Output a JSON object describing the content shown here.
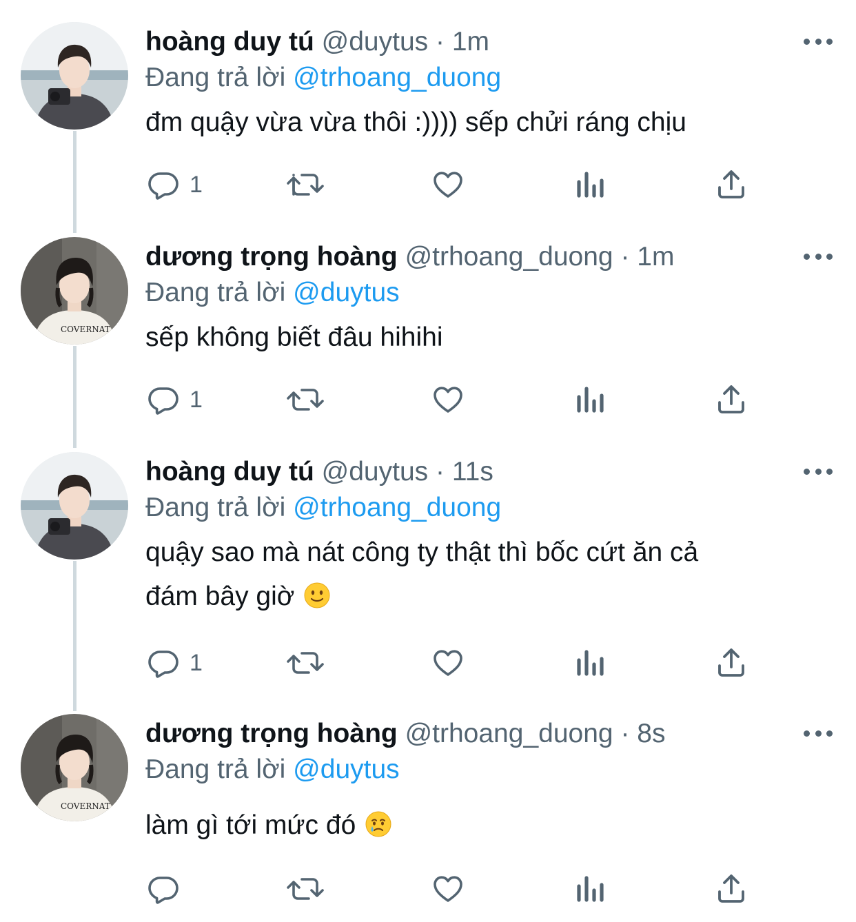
{
  "thread": {
    "reply_prefix": "Đang trả lời",
    "dot": "·",
    "tweets": [
      {
        "name": "hoàng duy tú",
        "handle": "@duytus",
        "time": "1m",
        "reply_to": "@trhoang_duong",
        "text": "đm quậy vừa vừa thôi :)))) sếp chửi ráng chịu",
        "emoji": "",
        "reply_count": "1",
        "avatar": "avatar-duytus"
      },
      {
        "name": "dương trọng hoàng",
        "handle": "@trhoang_duong",
        "time": "1m",
        "reply_to": "@duytus",
        "text": "sếp không biết đâu hihihi",
        "emoji": "",
        "reply_count": "1",
        "avatar": "avatar-trhoang",
        "shirt_text": "COVERNAT"
      },
      {
        "name": "hoàng duy tú",
        "handle": "@duytus",
        "time": "11s",
        "reply_to": "@trhoang_duong",
        "text_line1": "quậy sao mà nát công ty thật thì bốc cứt ăn cả",
        "text_line2": "đám bây giờ",
        "emoji": "slightly-smiling-face",
        "reply_count": "1",
        "avatar": "avatar-duytus"
      },
      {
        "name": "dương trọng hoàng",
        "handle": "@trhoang_duong",
        "time": "8s",
        "reply_to": "@duytus",
        "text": "làm gì tới mức đó",
        "emoji": "crying-face",
        "reply_count": "",
        "avatar": "avatar-trhoang",
        "shirt_text": "COVERNAT"
      }
    ]
  },
  "colors": {
    "text": "#0f1419",
    "secondary": "#536471",
    "link": "#1d9bf0",
    "thread_line": "#cfd9de"
  },
  "icons": [
    "reply-icon",
    "retweet-icon",
    "like-icon",
    "views-icon",
    "share-icon",
    "more-icon"
  ]
}
